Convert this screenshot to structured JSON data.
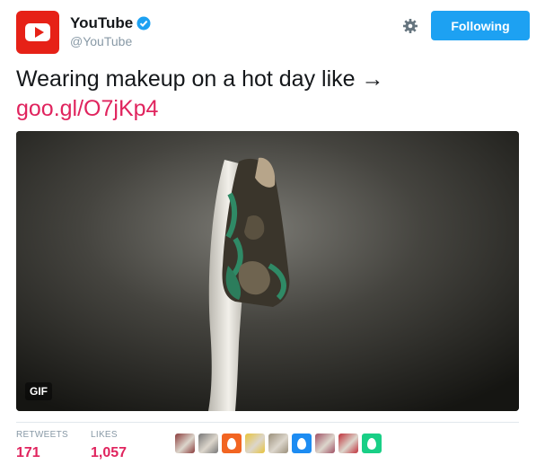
{
  "header": {
    "display_name": "YouTube",
    "handle": "@YouTube",
    "follow_label": "Following"
  },
  "tweet": {
    "text": "Wearing makeup on a hot day like →",
    "link": "goo.gl/O7jKp4"
  },
  "media": {
    "badge": "GIF"
  },
  "stats": {
    "retweets_label": "RETWEETS",
    "retweets_value": "171",
    "likes_label": "LIKES",
    "likes_value": "1,057"
  },
  "likers": [
    {
      "kind": "photo",
      "color": "#8a3b3b"
    },
    {
      "kind": "photo",
      "color": "#777777"
    },
    {
      "kind": "egg",
      "color": "#f26522"
    },
    {
      "kind": "photo",
      "color": "#e8c33a"
    },
    {
      "kind": "photo",
      "color": "#9a8f7a"
    },
    {
      "kind": "egg",
      "color": "#1d8cf2"
    },
    {
      "kind": "photo",
      "color": "#a05064"
    },
    {
      "kind": "photo",
      "color": "#c0303a"
    },
    {
      "kind": "egg",
      "color": "#19cf86"
    }
  ],
  "colors": {
    "brand_red": "#e62117",
    "follow_blue": "#1da1f2",
    "link_pink": "#e0245e"
  }
}
